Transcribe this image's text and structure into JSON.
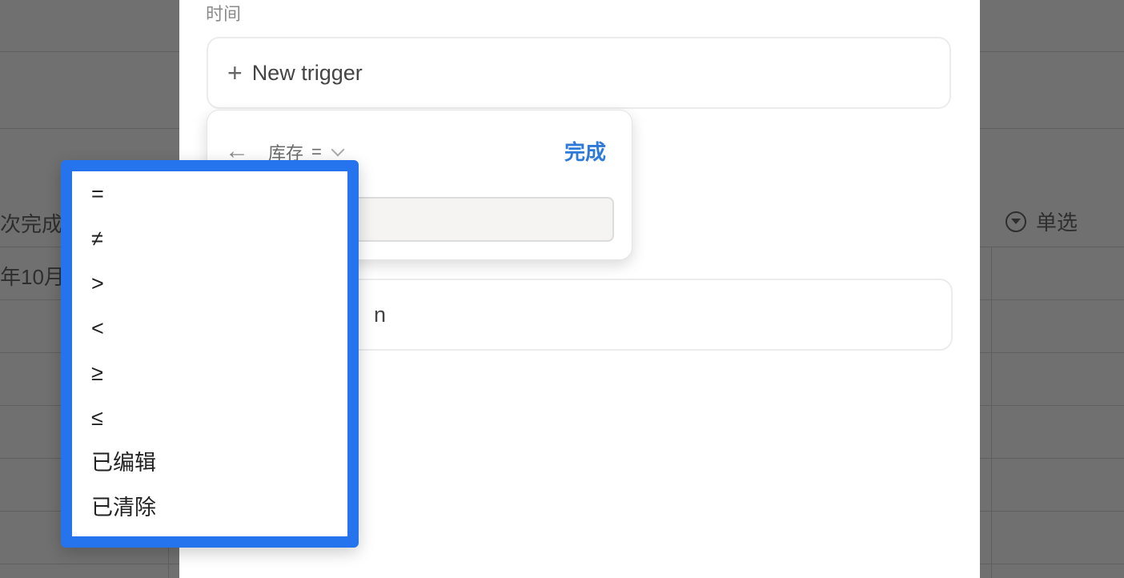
{
  "background": {
    "row_label_1": "次完成",
    "row_label_2": "年10月",
    "property_label": "单选"
  },
  "modal": {
    "section_label": "时间",
    "new_trigger_label": "New trigger",
    "action_partial_text": "n"
  },
  "popover": {
    "back_icon": "←",
    "property_name": "库存",
    "operator": "=",
    "done_label": "完成"
  },
  "dropdown": {
    "items": [
      "=",
      "≠",
      ">",
      "<",
      "≥",
      "≤",
      "已编辑",
      "已清除"
    ]
  },
  "colors": {
    "accent": "#2673ee",
    "done": "#2f7ad9"
  }
}
